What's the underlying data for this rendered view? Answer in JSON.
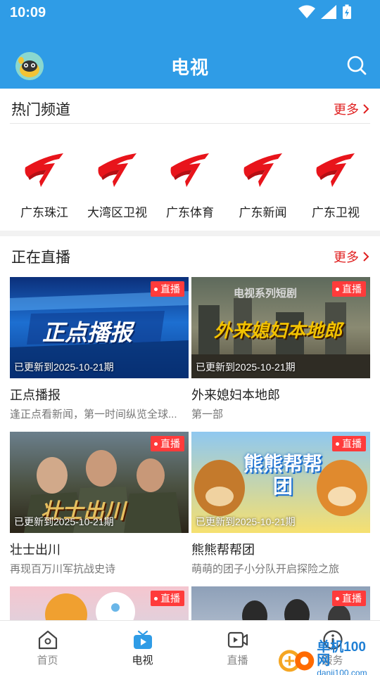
{
  "status": {
    "time": "10:09"
  },
  "header": {
    "title": "电视"
  },
  "hot": {
    "title": "热门频道",
    "more": "更多",
    "channels": [
      {
        "name": "广东珠江"
      },
      {
        "name": "大湾区卫视"
      },
      {
        "name": "广东体育"
      },
      {
        "name": "广东新闻"
      },
      {
        "name": "广东卫视"
      }
    ]
  },
  "live": {
    "title": "正在直播",
    "more": "更多",
    "badge": "直播",
    "cards": [
      {
        "title": "正点播报",
        "desc": "逢正点看新闻，第一时间纵览全球...",
        "updated": "已更新到2025-10-21期",
        "overlay": "正点播报"
      },
      {
        "title": "外来媳妇本地郎",
        "desc": "第一部",
        "updated": "已更新到2025-10-21期",
        "overlay": "外来媳妇本地郎",
        "top_caption": "电视系列短剧"
      },
      {
        "title": "壮士出川",
        "desc": "再现百万川军抗战史诗",
        "updated": "已更新到2025-10-21期",
        "overlay": "壮士出川"
      },
      {
        "title": "熊熊帮帮团",
        "desc": "萌萌的团子小分队开启探险之旅",
        "updated": "已更新到2025-10-21期",
        "overlay": "熊熊帮帮团"
      },
      {
        "title": "",
        "desc": "",
        "updated": ""
      },
      {
        "title": "",
        "desc": "",
        "updated": ""
      }
    ]
  },
  "nav": {
    "items": [
      {
        "label": "首页",
        "icon": "home-icon"
      },
      {
        "label": "电视",
        "icon": "tv-icon"
      },
      {
        "label": "直播",
        "icon": "video-icon"
      },
      {
        "label": "服务",
        "icon": "info-icon"
      }
    ]
  },
  "watermark": {
    "main": "单机100网",
    "sub": "danji100.com"
  },
  "colors": {
    "accent": "#2f9ce6",
    "live_red": "#ff3b3b",
    "more_red": "#e02020"
  }
}
